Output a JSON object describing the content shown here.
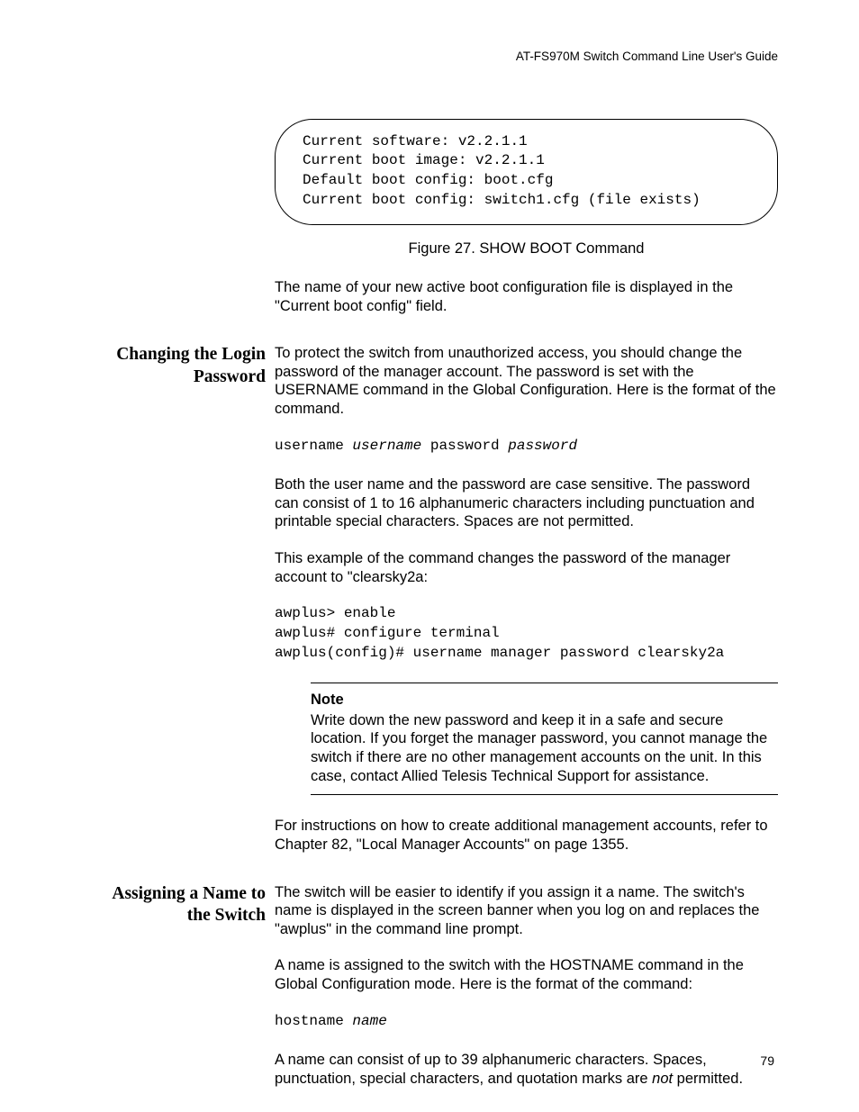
{
  "header": {
    "running": "AT-FS970M Switch Command Line User's Guide"
  },
  "codebox": {
    "l1": "Current software: v2.2.1.1",
    "l2": "Current boot image: v2.2.1.1",
    "l3": "Default boot config: boot.cfg",
    "l4": "Current boot config: switch1.cfg (file exists)"
  },
  "fig_caption": "Figure 27. SHOW BOOT Command",
  "intro_para": "The name of your new active boot configuration file is displayed in the \"Current boot config\" field.",
  "sec1": {
    "heading": "Changing the Login Password",
    "p1": "To protect the switch from unauthorized access, you should change the password of the manager account. The password is set with the USERNAME command in the Global Configuration. Here is the format of the command.",
    "cmd_pre": "username ",
    "cmd_v1": "username",
    "cmd_mid": " password ",
    "cmd_v2": "password",
    "p2": "Both the user name and the password are case sensitive. The password can consist of 1 to 16 alphanumeric characters including punctuation and printable special characters. Spaces are not permitted.",
    "p3": "This example of the command changes the password of the manager account to \"clearsky2a:",
    "ex_l1": "awplus> enable",
    "ex_l2": "awplus# configure terminal",
    "ex_l3": "awplus(config)# username manager password clearsky2a",
    "note_title": "Note",
    "note_body": "Write down the new password and keep it in a safe and secure location. If you forget the manager password, you cannot manage the switch if there are no other management accounts on the unit. In this case, contact Allied Telesis Technical Support for assistance.",
    "p4": "For instructions on how to create additional management accounts, refer to Chapter 82, \"Local Manager Accounts\" on page 1355."
  },
  "sec2": {
    "heading": "Assigning a Name to the Switch",
    "p1": "The switch will be easier to identify if you assign it a name. The switch's name is displayed in the screen banner when you log on and replaces the \"awplus\" in the command line prompt.",
    "p2": "A name is assigned to the switch with the HOSTNAME command in the Global Configuration mode. Here is the format of the command:",
    "cmd_pre": "hostname ",
    "cmd_v1": "name",
    "p3_a": "A name can consist of up to 39 alphanumeric characters. Spaces, punctuation, special characters, and quotation marks are ",
    "p3_em": "not",
    "p3_b": " permitted."
  },
  "page_number": "79"
}
